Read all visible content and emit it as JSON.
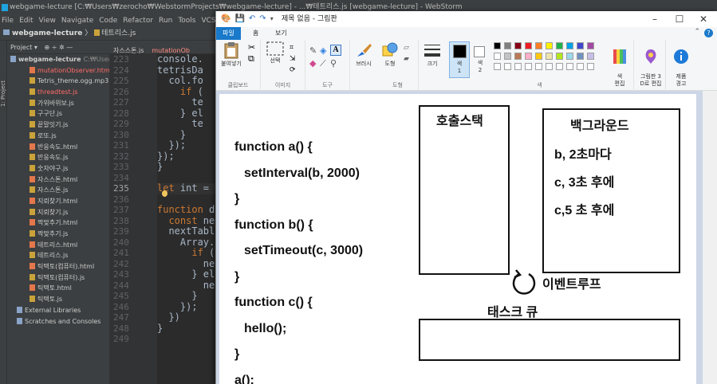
{
  "webstorm": {
    "title": "webgame-lecture [C:₩Users₩zerocho₩WebstormProjects₩webgame-lecture] - ...₩테트리스.js [webgame-lecture] - WebStorm",
    "menu": [
      "File",
      "Edit",
      "View",
      "Navigate",
      "Code",
      "Refactor",
      "Run",
      "Tools",
      "VCS",
      "Window"
    ],
    "breadcrumb": {
      "project": "webgame-lecture",
      "file": "테트리스.js"
    },
    "stripe_label": "1: Project",
    "project_header": "Project ▾",
    "tree_root": "webgame-lecture",
    "tree_root_path": "C:₩Users",
    "tree_items": [
      {
        "name": "mutationObserver.html",
        "kind": "html",
        "red": true
      },
      {
        "name": "Tetris_theme.ogg.mp3",
        "kind": "file",
        "red": false
      },
      {
        "name": "threadtest.js",
        "kind": "js",
        "red": true
      },
      {
        "name": "가위바위보.js",
        "kind": "js",
        "red": false
      },
      {
        "name": "구구단.js",
        "kind": "js",
        "red": false
      },
      {
        "name": "끝말잇기.js",
        "kind": "js",
        "red": false
      },
      {
        "name": "로또.js",
        "kind": "js",
        "red": false
      },
      {
        "name": "반응속도.html",
        "kind": "html",
        "red": false
      },
      {
        "name": "반응속도.js",
        "kind": "js",
        "red": false
      },
      {
        "name": "숫자야구.js",
        "kind": "js",
        "red": false
      },
      {
        "name": "자스스톤.html",
        "kind": "html",
        "red": false
      },
      {
        "name": "자스스톤.js",
        "kind": "js",
        "red": false
      },
      {
        "name": "지뢰찾기.html",
        "kind": "html",
        "red": false
      },
      {
        "name": "지뢰찾기.js",
        "kind": "js",
        "red": false
      },
      {
        "name": "짝맞추기.html",
        "kind": "html",
        "red": false
      },
      {
        "name": "짝맞추기.js",
        "kind": "js",
        "red": false
      },
      {
        "name": "테트리스.html",
        "kind": "html",
        "red": false
      },
      {
        "name": "테트리스.js",
        "kind": "js",
        "red": false
      },
      {
        "name": "틱택토(컴퓨터).html",
        "kind": "html",
        "red": false
      },
      {
        "name": "틱택토(컴퓨터).js",
        "kind": "js",
        "red": false
      },
      {
        "name": "틱택토.html",
        "kind": "html",
        "red": false
      },
      {
        "name": "틱택토.js",
        "kind": "js",
        "red": false
      }
    ],
    "external_libraries": "External Libraries",
    "scratches": "Scratches and Consoles",
    "editor_tabs": [
      {
        "label": "자스스톤.js",
        "active": false,
        "red": false
      },
      {
        "label": "mutationOb",
        "active": false,
        "red": true
      }
    ],
    "line_numbers": [
      "223",
      "224",
      "225",
      "226",
      "227",
      "228",
      "229",
      "230",
      "231",
      "232",
      "233",
      "234",
      "235",
      "236",
      "237",
      "238",
      "239",
      "240",
      "241",
      "242",
      "243",
      "244",
      "245",
      "246",
      "247",
      "248",
      "249"
    ],
    "current_line_index": 12,
    "code_lines": [
      {
        "text": "console."
      },
      {
        "text": "tetrisDa"
      },
      {
        "text": "  col.fo"
      },
      {
        "text": "    if ("
      },
      {
        "text": "      te"
      },
      {
        "text": "    } el"
      },
      {
        "text": "      te"
      },
      {
        "text": "    }"
      },
      {
        "text": "  });"
      },
      {
        "text": "});"
      },
      {
        "text": "}"
      },
      {
        "text": ""
      },
      {
        "text": "let int = "
      },
      {
        "text": ""
      },
      {
        "text": "function d"
      },
      {
        "text": "  const ne"
      },
      {
        "text": "  nextTabl"
      },
      {
        "text": "    Array."
      },
      {
        "text": "      if ("
      },
      {
        "text": "        ne"
      },
      {
        "text": "      } el"
      },
      {
        "text": "        ne"
      },
      {
        "text": "      }"
      },
      {
        "text": "    });"
      },
      {
        "text": "  })"
      },
      {
        "text": "}"
      },
      {
        "text": ""
      }
    ]
  },
  "paint": {
    "title": "제목 없음 - 그림판",
    "window_controls": {
      "minimize": "–",
      "maximize": "☐",
      "close": "✕"
    },
    "tabs": {
      "file": "파일",
      "home": "홈",
      "view": "보기"
    },
    "ribbon": {
      "paste": "붙여넣기",
      "clipboard": "클립보드",
      "select": "선택",
      "image": "이미지",
      "tools": "도구",
      "brushes": "브러시",
      "shapes": "도형",
      "shapes_group": "도형",
      "size": "크기",
      "color1": "색\n1",
      "color2": "색\n2",
      "edit_colors": "색\n편집",
      "colors_group": "색",
      "paint3d": "그림판 3\nD로 편집",
      "product_alert": "제품\n경고"
    },
    "palette": [
      "#000000",
      "#7f7f7f",
      "#880015",
      "#ed1c24",
      "#ff7f27",
      "#fff200",
      "#22b14c",
      "#00a2e8",
      "#3f48cc",
      "#a349a4",
      "#ffffff",
      "#c3c3c3",
      "#b97a57",
      "#ffaec9",
      "#ffc90e",
      "#efe4b0",
      "#b5e61d",
      "#99d9ea",
      "#7092be",
      "#c8bfe7"
    ],
    "canvas": {
      "code": [
        "function a() {",
        "setInterval(b, 2000)",
        "}",
        "function b() {",
        "setTimeout(c, 3000)",
        "}",
        "function c() {",
        "hello();",
        "}",
        "a();"
      ],
      "call_stack_label": "호출스택",
      "background_label": "백그라운드",
      "background_items": [
        "b, 2초마다",
        "c, 3초 후에",
        "c,5 초 후에"
      ],
      "event_loop_label": "이벤트루프",
      "task_queue_label": "태스크 큐"
    }
  }
}
